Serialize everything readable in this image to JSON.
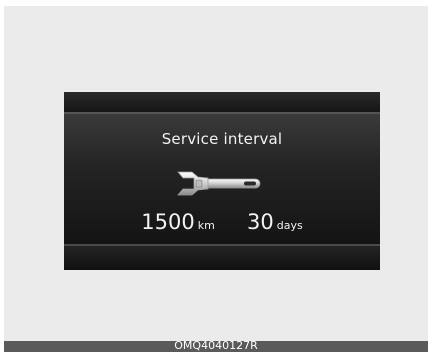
{
  "display": {
    "title": "Service interval",
    "icon": "wrench-icon",
    "distance": {
      "value": "1500",
      "unit": "km"
    },
    "time": {
      "value": "30",
      "unit": "days"
    }
  },
  "caption": {
    "code": "OMQ4040127R"
  },
  "colors": {
    "screen_background": "#1c1c1c",
    "text": "#f2f2f2",
    "caption_bar": "#5a5a5a"
  }
}
